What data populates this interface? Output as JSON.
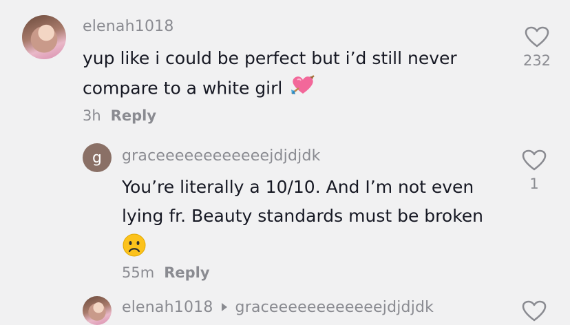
{
  "comments": [
    {
      "username": "elenah1018",
      "text_line1": "yup like i could be perfect but i’d still never",
      "text_line2": "compare to a white girl",
      "emoji": "heart-with-arrow",
      "time": "3h",
      "reply_label": "Reply",
      "likes": "232"
    },
    {
      "avatar_letter": "g",
      "username": "graceeeeeeeeeeeejdjdjdk",
      "text_line1": "You’re literally a 10/10. And I’m not even",
      "text_line2": "lying fr. Beauty standards must be broken",
      "emoji": "frowning-face",
      "time": "55m",
      "reply_label": "Reply",
      "likes": "1"
    },
    {
      "username": "elenah1018",
      "reply_to": "graceeeeeeeeeeeejdjdjdk"
    }
  ],
  "colors": {
    "background": "#f1f1f2",
    "text": "#161823",
    "muted": "#8a8b91"
  }
}
